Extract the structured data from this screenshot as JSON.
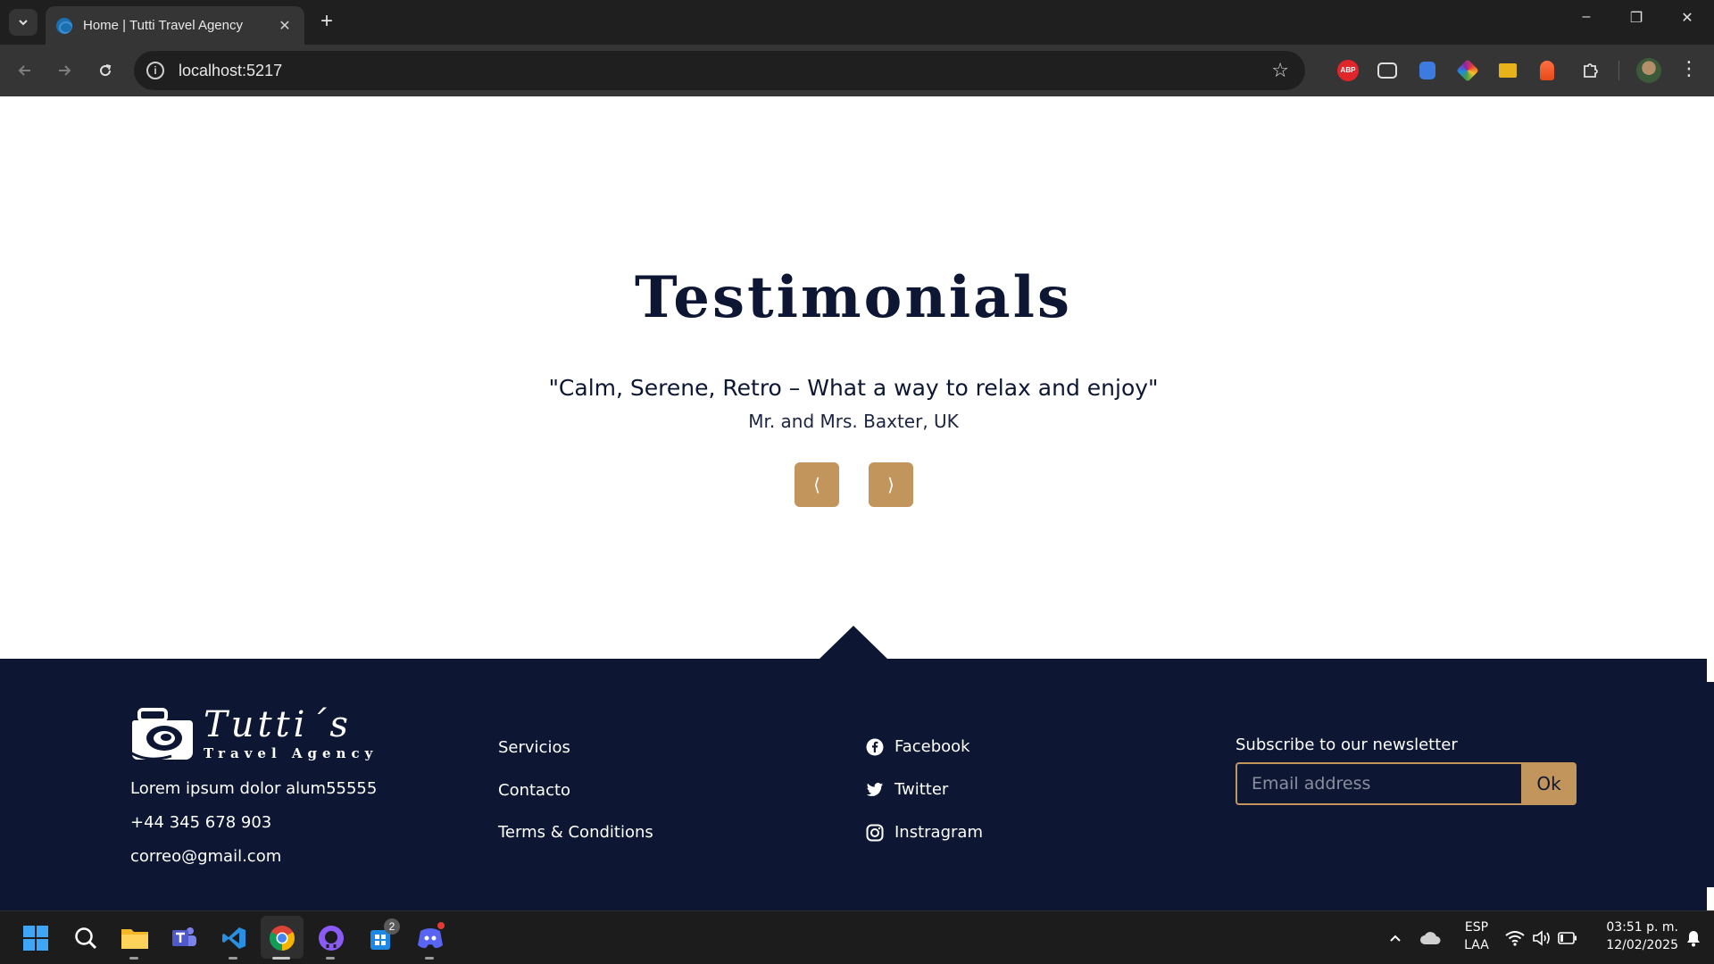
{
  "browser": {
    "tab_title": "Home | Tutti Travel Agency",
    "tab_close": "✕",
    "new_tab": "+",
    "url": "localhost:5217",
    "window_controls": {
      "minimize": "–",
      "restore": "❐",
      "close": "✕"
    },
    "extensions": [
      "abp-icon",
      "picture-in-picture-icon",
      "notes-icon",
      "color-picker-icon",
      "tag-icon",
      "rocket-icon",
      "puzzle-icon"
    ],
    "abp_label": "ABP"
  },
  "testimonials": {
    "title": "Testimonials",
    "quote": "\"Calm, Serene, Retro – What a way to relax and enjoy\"",
    "author": "Mr. and Mrs. Baxter, UK",
    "prev_label": "⟨",
    "next_label": "⟩"
  },
  "footer": {
    "logo": {
      "name": "Tutti´s",
      "subtitle": "Travel Agency"
    },
    "contact": {
      "address": "Lorem ipsum dolor alum55555",
      "phone": "+44 345 678 903",
      "email": "correo@gmail.com"
    },
    "links": [
      "Servicios",
      "Contacto",
      "Terms & Conditions"
    ],
    "social": [
      {
        "label": "Facebook",
        "icon": "facebook-icon"
      },
      {
        "label": "Twitter",
        "icon": "twitter-icon"
      },
      {
        "label": "Instragram",
        "icon": "instagram-icon"
      }
    ],
    "newsletter": {
      "title": "Subscribe to our newsletter",
      "placeholder": "Email address",
      "button": "Ok"
    }
  },
  "colors": {
    "navy": "#0d1733",
    "gold": "#c2955d",
    "white": "#ffffff"
  },
  "taskbar": {
    "apps": [
      "windows-start-icon",
      "search-icon",
      "file-explorer-icon",
      "teams-icon",
      "vscode-icon",
      "chrome-icon",
      "github-desktop-icon",
      "app-badge-icon",
      "discord-icon"
    ],
    "badge_count": "2",
    "language": "ESP",
    "layout": "LAA",
    "time": "03:51 p. m.",
    "date": "12/02/2025"
  }
}
